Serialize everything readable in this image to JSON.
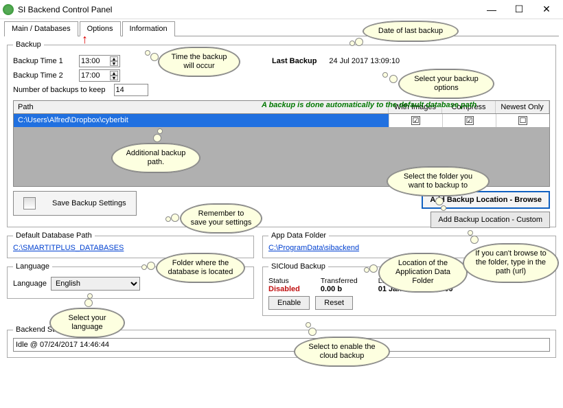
{
  "window": {
    "title": "SI Backend Control Panel"
  },
  "tabs": {
    "main": "Main / Databases",
    "options": "Options",
    "info": "Information"
  },
  "backup": {
    "legend": "Backup",
    "time1_label": "Backup Time 1",
    "time1": "13:00",
    "time2_label": "Backup Time 2",
    "time2": "17:00",
    "keep_label": "Number of backups to keep",
    "keep": "14",
    "last_label": "Last Backup",
    "last_value": "24 Jul 2017 13:09:10",
    "auto_note": "A backup is done automatically to the default database path"
  },
  "table": {
    "h_path": "Path",
    "h_images": "With Images",
    "h_compress": "Compress",
    "h_newest": "Newest Only",
    "row": {
      "path": "C:\\Users\\Alfred\\Dropbox\\cyberbit",
      "images": true,
      "compress": true,
      "newest": false
    }
  },
  "buttons": {
    "save": "Save Backup Settings",
    "add_browse": "Add Backup Location - Browse",
    "add_custom": "Add Backup Location - Custom"
  },
  "defaultdb": {
    "legend": "Default Database Path",
    "path": "C:\\SMARTITPLUS_DATABASES"
  },
  "language": {
    "legend": "Language",
    "label": "Language",
    "value": "English"
  },
  "appdata": {
    "legend": "App Data Folder",
    "path": "C:\\ProgramData\\sibackend"
  },
  "cloud": {
    "legend": "SICloud Backup",
    "status_h": "Status",
    "status_v": "Disabled",
    "trans_h": "Transferred",
    "trans_v": "0.00 b",
    "upload_h": "Last Upload",
    "upload_v": "01 Jan 0001 00:00:00",
    "enable": "Enable",
    "reset": "Reset"
  },
  "status": {
    "legend": "Backend Status",
    "value": "Idle @ 07/24/2017 14:46:44"
  },
  "callouts": {
    "c1": "Time the backup will occur",
    "c2": "Date of last backup",
    "c3": "Select your backup options",
    "c4": "Additional backup path.",
    "c5": "Select the folder you want to backup to",
    "c6": "Remember to save your settings",
    "c7": "Folder where the database is located",
    "c8": "Location of the Application Data Folder",
    "c9": "If you can't browse to the folder, type in the path (url)",
    "c10": "Select your language",
    "c11": "Select to enable the cloud backup"
  }
}
